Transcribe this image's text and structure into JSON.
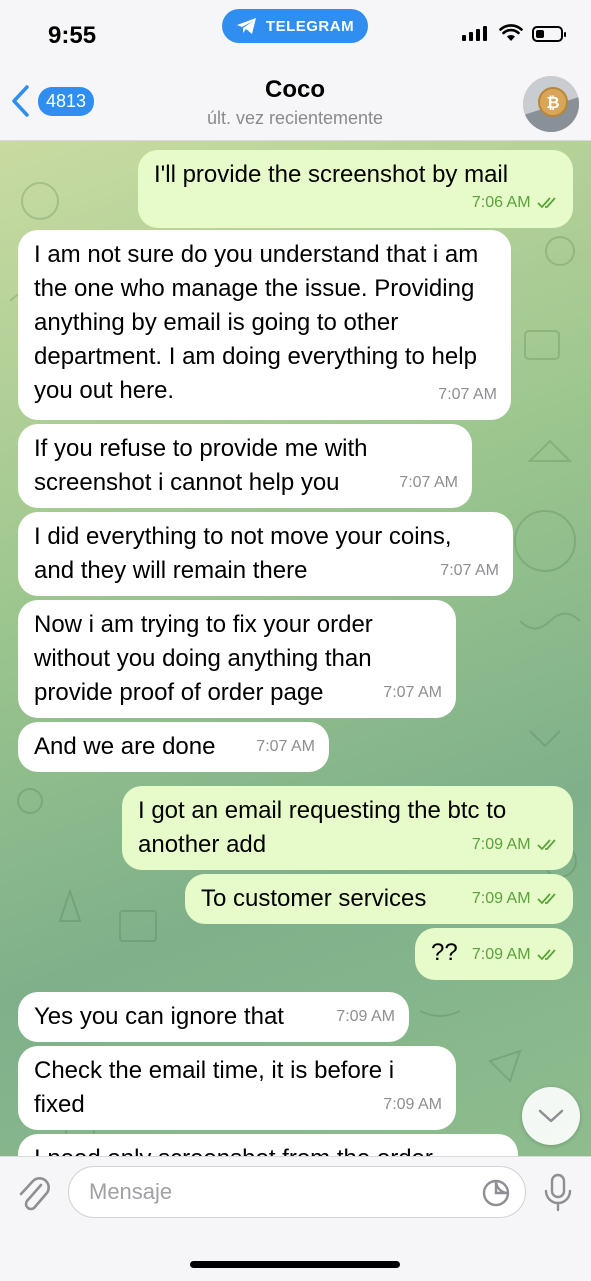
{
  "status_bar": {
    "time": "9:55",
    "app_pill": "TELEGRAM"
  },
  "header": {
    "back_count": "4813",
    "title": "Coco",
    "subtitle": "últ. vez recientemente"
  },
  "messages": [
    {
      "dir": "out",
      "text": "I'll provide the screenshot by mail",
      "time": "7:06 AM"
    },
    {
      "dir": "in",
      "text": "I am not sure do you understand that i am the one who manage the issue. Providing anything by email is going to other department. I am doing everything to help you out here.",
      "time": "7:07 AM"
    },
    {
      "dir": "in",
      "text": "If you refuse to provide me with screenshot i cannot help you",
      "time": "7:07 AM"
    },
    {
      "dir": "in",
      "text": "I did everything to not move your coins, and they will remain there",
      "time": "7:07 AM"
    },
    {
      "dir": "in",
      "text": "Now i am trying to fix your order without you doing anything than provide proof of order page",
      "time": "7:07 AM"
    },
    {
      "dir": "in",
      "text": "And we are done",
      "time": "7:07 AM"
    },
    {
      "dir": "out",
      "text": "I got an email requesting the btc to another add",
      "time": "7:09 AM"
    },
    {
      "dir": "out",
      "text": "To customer services",
      "time": "7:09 AM"
    },
    {
      "dir": "out",
      "text": "??",
      "time": "7:09 AM"
    },
    {
      "dir": "in",
      "text": "Yes you can ignore that",
      "time": "7:09 AM"
    },
    {
      "dir": "in",
      "text": "Check the email time, it is before i fixed",
      "time": "7:09 AM"
    },
    {
      "dir": "in",
      "text": "I need only screenshot from the order",
      "time": ""
    }
  ],
  "input": {
    "placeholder": "Mensaje"
  },
  "colors": {
    "accent": "#2f8ef0",
    "outgoing_bubble": "#e6fbc9",
    "incoming_bubble": "#ffffff",
    "read_check": "#5aa33b"
  }
}
